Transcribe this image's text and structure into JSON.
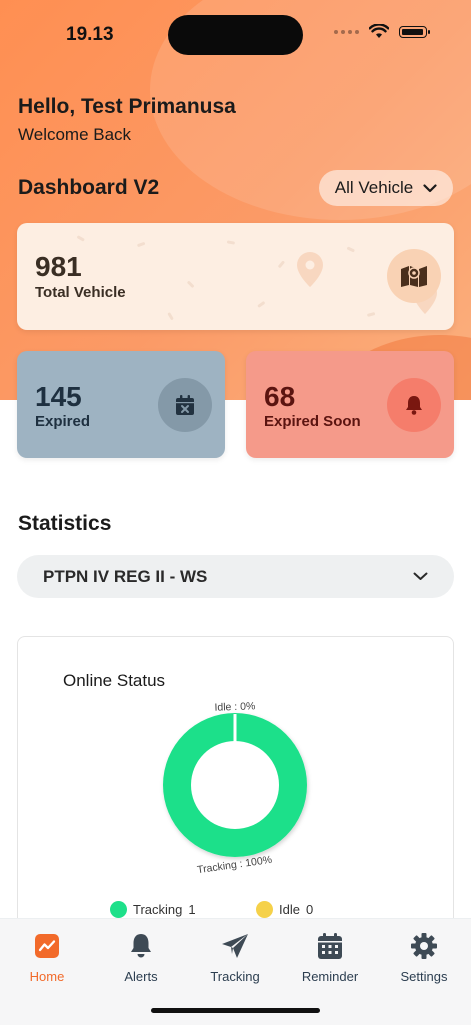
{
  "status_bar": {
    "time": "19.13"
  },
  "header": {
    "greeting": "Hello, Test Primanusa",
    "subtitle": "Welcome Back",
    "dashboard_title": "Dashboard V2",
    "vehicle_filter": "All Vehicle"
  },
  "summary": {
    "total": {
      "value": "981",
      "label": "Total Vehicle",
      "icon": "map-icon"
    },
    "expired": {
      "value": "145",
      "label": "Expired",
      "icon": "calendar-x-icon"
    },
    "expired_soon": {
      "value": "68",
      "label": "Expired Soon",
      "icon": "bell-icon"
    }
  },
  "statistics": {
    "title": "Statistics",
    "region": "PTPN IV REG II - WS",
    "chart": {
      "title": "Online Status",
      "idle_callout": "Idle : 0%",
      "tracking_callout": "Tracking : 100%",
      "legend": [
        {
          "name": "Tracking",
          "count": "1",
          "color": "#1ee08a"
        },
        {
          "name": "Idle",
          "count": "0",
          "color": "#f5d14a"
        }
      ]
    }
  },
  "chart_data": {
    "type": "pie",
    "title": "Online Status",
    "categories": [
      "Tracking",
      "Idle"
    ],
    "values": [
      1,
      0
    ],
    "percent": [
      100,
      0
    ],
    "colors": [
      "#1ee08a",
      "#f5d14a"
    ],
    "legend_position": "bottom"
  },
  "tabbar": {
    "items": [
      {
        "label": "Home",
        "icon": "chart-trend-icon",
        "active": true
      },
      {
        "label": "Alerts",
        "icon": "bell-icon"
      },
      {
        "label": "Tracking",
        "icon": "send-plane-icon"
      },
      {
        "label": "Reminder",
        "icon": "calendar-icon"
      },
      {
        "label": "Settings",
        "icon": "gear-icon"
      }
    ]
  },
  "colors": {
    "accent": "#f26a2a",
    "hero_orange": "#ff8f52",
    "expired_card": "#9eb3c2",
    "expired_soon_card": "#f59a8a",
    "tracking": "#1ee08a",
    "idle": "#f5d14a"
  }
}
